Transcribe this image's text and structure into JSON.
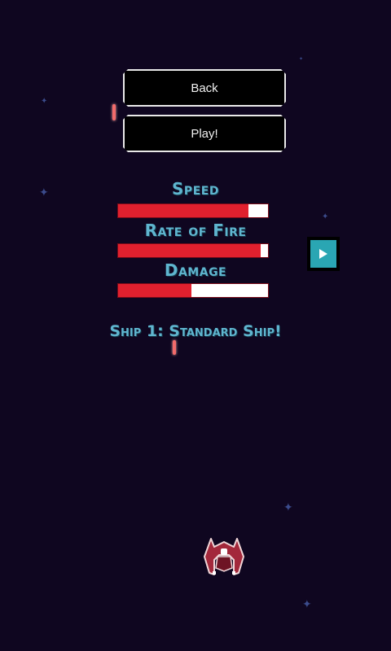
{
  "menu": {
    "back_label": "Back",
    "play_label": "Play!"
  },
  "stats": [
    {
      "label": "Speed",
      "fill": 0.87
    },
    {
      "label": "Rate of Fire",
      "fill": 0.95
    },
    {
      "label": "Damage",
      "fill": 0.49
    }
  ],
  "ship": {
    "name": "Ship 1: Standard Ship!"
  },
  "colors": {
    "background": "#0f0620",
    "label": "#5fb5cf",
    "bar_fill": "#e0202e",
    "bar_empty": "#ffffff",
    "next_button": "#2aa6b3"
  },
  "icons": {
    "next": "play-triangle-icon"
  }
}
